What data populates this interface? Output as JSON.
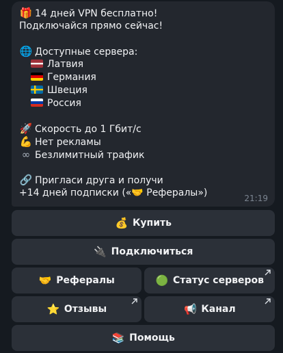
{
  "message": {
    "lines": [
      {
        "icon": "🎁",
        "text": "14 дней VPN бесплатно!"
      },
      {
        "text": "Подключайся прямо сейчас!"
      },
      {
        "text": ""
      },
      {
        "icon": "🌐",
        "text": "Доступные сервера:"
      },
      {
        "flag": "latvia",
        "text": "Латвия"
      },
      {
        "flag": "germany",
        "text": "Германия"
      },
      {
        "flag": "sweden",
        "text": "Швеция"
      },
      {
        "flag": "russia",
        "text": "Россия"
      },
      {
        "text": ""
      },
      {
        "icon": "🚀",
        "text": "Скорость до 1 Гбит/с"
      },
      {
        "icon": "💪",
        "text": "Нет рекламы"
      },
      {
        "icon": "∞",
        "text": "Безлимитный трафик"
      },
      {
        "text": ""
      },
      {
        "icon": "🔗",
        "text": "Пригласи друга и получи"
      },
      {
        "text": "+14 дней подписки («🤝 Рефералы»)"
      }
    ],
    "time": "21:19"
  },
  "buttons": {
    "buy": {
      "icon": "💰",
      "label": "Купить"
    },
    "connect": {
      "icon": "🔌",
      "label": "Подключиться"
    },
    "referrals": {
      "icon": "🤝",
      "label": "Рефералы"
    },
    "server_status": {
      "icon": "🟢",
      "label": "Статус серверов"
    },
    "reviews": {
      "icon": "⭐",
      "label": "Отзывы"
    },
    "channel": {
      "icon": "📢",
      "label": "Канал"
    },
    "help": {
      "icon": "📚",
      "label": "Помощь"
    }
  },
  "colors": {
    "background": "#151a20",
    "bubble": "#23272e",
    "button": "#2b3038",
    "time": "#7c8591"
  }
}
